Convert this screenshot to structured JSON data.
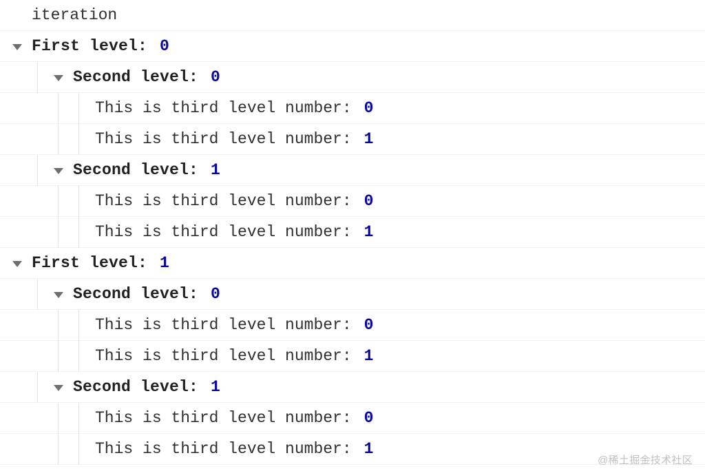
{
  "log": {
    "header": "iteration",
    "levels": {
      "first": {
        "label": "First level:"
      },
      "second": {
        "label": "Second level:"
      },
      "third": {
        "label": "This is third level number:"
      }
    },
    "tree": [
      {
        "value": 0,
        "children": [
          {
            "value": 0,
            "children": [
              {
                "value": 0
              },
              {
                "value": 1
              }
            ]
          },
          {
            "value": 1,
            "children": [
              {
                "value": 0
              },
              {
                "value": 1
              }
            ]
          }
        ]
      },
      {
        "value": 1,
        "children": [
          {
            "value": 0,
            "children": [
              {
                "value": 0
              },
              {
                "value": 1
              }
            ]
          },
          {
            "value": 1,
            "children": [
              {
                "value": 0
              },
              {
                "value": 1
              }
            ]
          }
        ]
      }
    ]
  },
  "watermark": "@稀土掘金技术社区"
}
